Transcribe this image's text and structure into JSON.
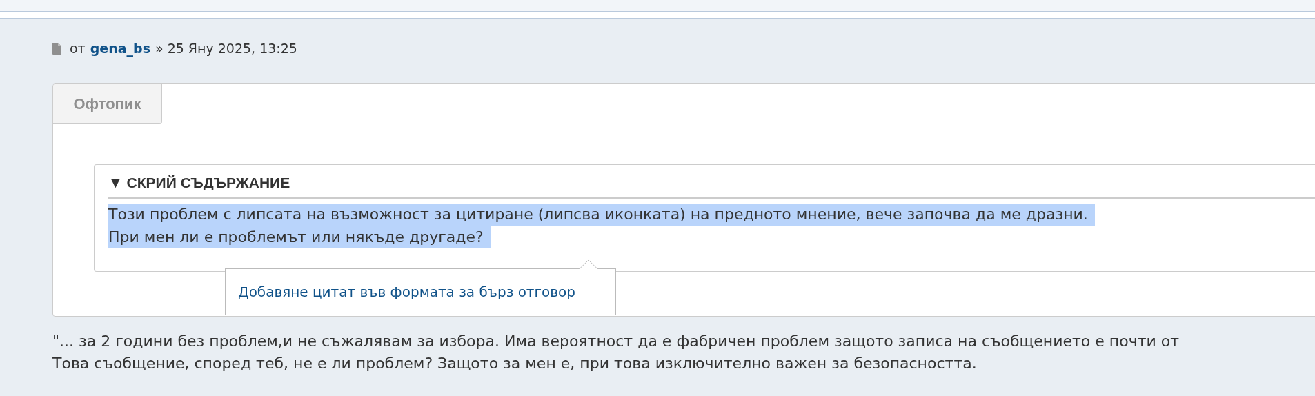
{
  "post": {
    "prefix": "от",
    "author": "gena_bs",
    "separator": "»",
    "date": "25 Яну 2025, 13:25"
  },
  "tab": {
    "label": "Офтопик",
    "selected": true
  },
  "spoiler": {
    "toggle": "▼ СКРИЙ СЪДЪРЖАНИЕ",
    "expanded": true,
    "highlighted": true,
    "lines": [
      "Този проблем с липсата на възможност за цитиране (липсва иконката) на предното мнение, вече започва да ме дразни.",
      "При мен ли е проблемът или някъде другаде?"
    ]
  },
  "quote_popup": {
    "link": "Добавяне цитат във формата за бърз отговор"
  },
  "body_lines": [
    "\"... за 2 години без проблем,и не съжалявам за избора. Има вероятност да е фабричен проблем защото записа на съобщението е почти от",
    "Това съобщение, според теб, не е ли проблем? Защото за мен е, при това изключително важен за безопасността."
  ]
}
